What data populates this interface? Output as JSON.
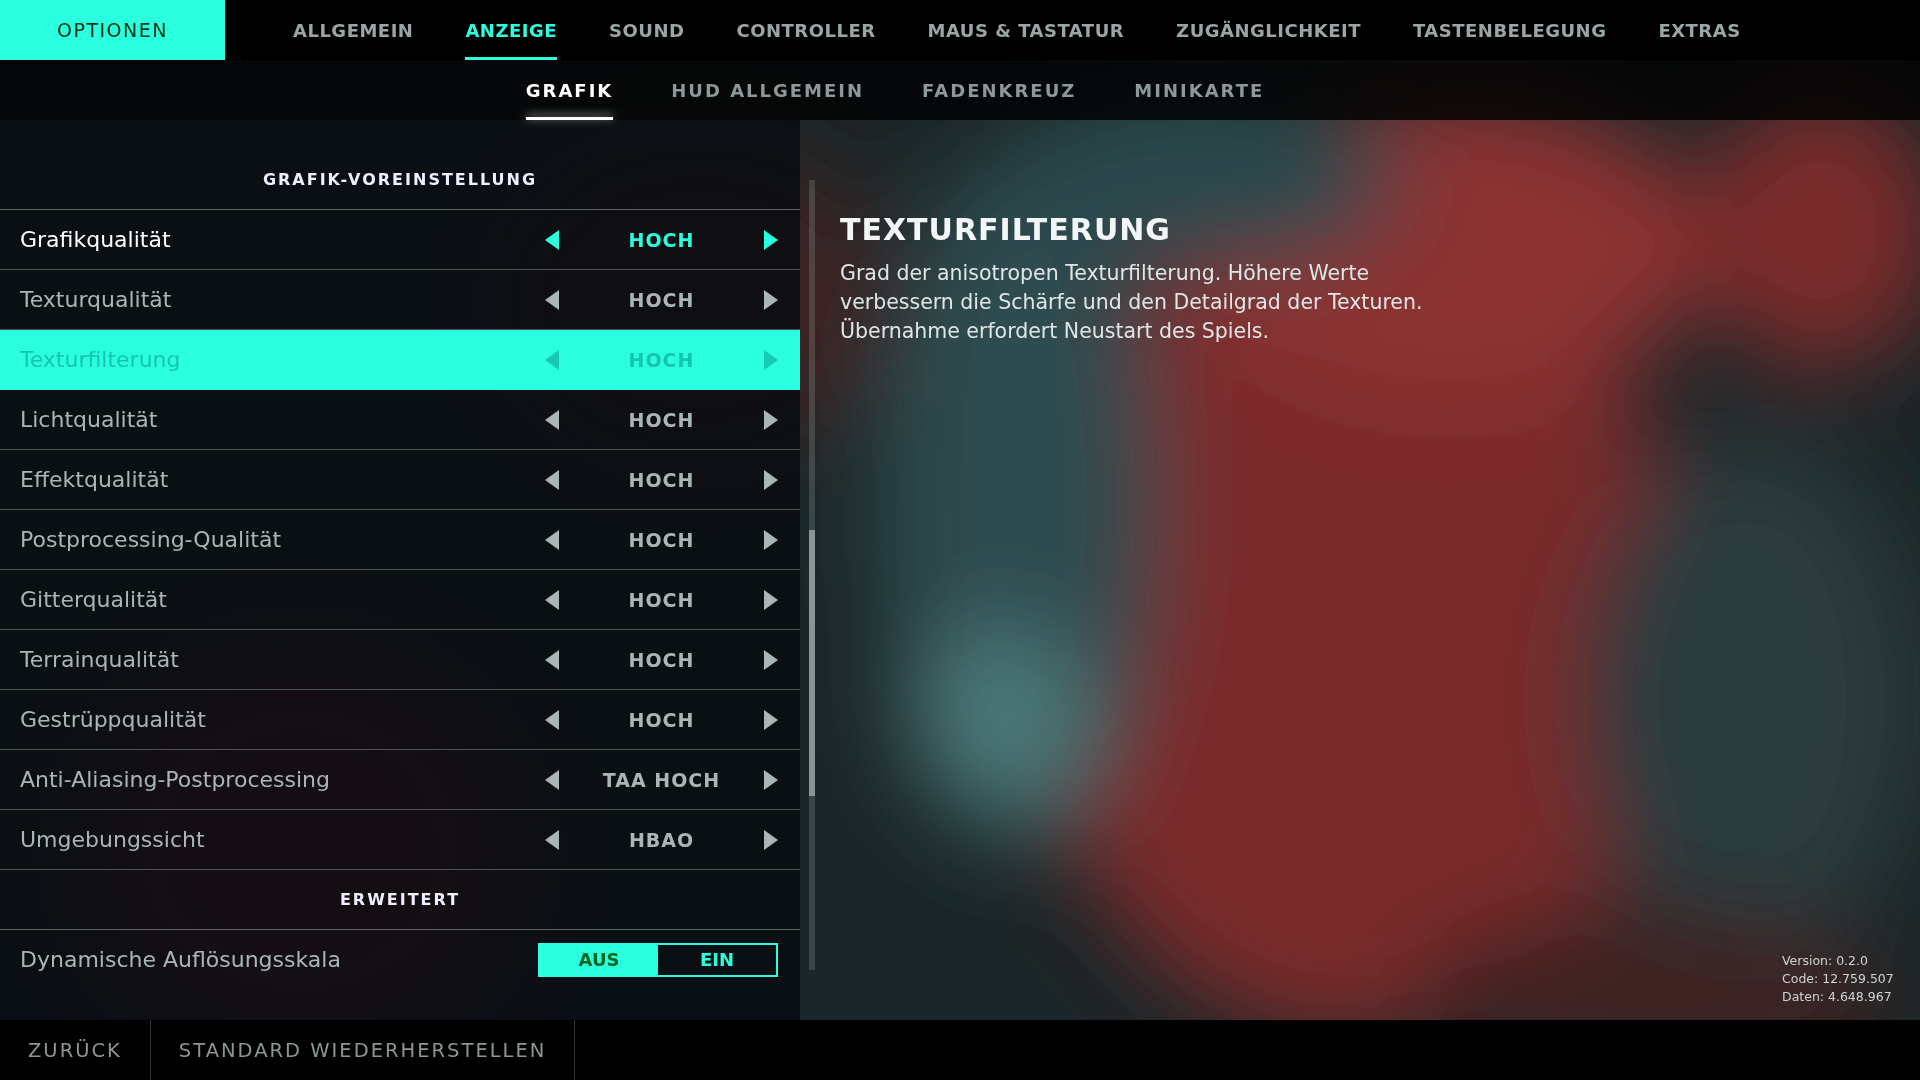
{
  "header": {
    "title": "OPTIONEN"
  },
  "tabs": [
    {
      "label": "ALLGEMEIN",
      "selected": false
    },
    {
      "label": "ANZEIGE",
      "selected": true
    },
    {
      "label": "SOUND",
      "selected": false
    },
    {
      "label": "CONTROLLER",
      "selected": false
    },
    {
      "label": "MAUS & TASTATUR",
      "selected": false
    },
    {
      "label": "ZUGÄNGLICHKEIT",
      "selected": false
    },
    {
      "label": "TASTENBELEGUNG",
      "selected": false
    },
    {
      "label": "EXTRAS",
      "selected": false
    }
  ],
  "subtabs": [
    {
      "label": "GRAFIK",
      "selected": true
    },
    {
      "label": "HUD ALLGEMEIN",
      "selected": false
    },
    {
      "label": "FADENKREUZ",
      "selected": false
    },
    {
      "label": "MINIKARTE",
      "selected": false
    }
  ],
  "settings": [
    {
      "kind": "heading",
      "label": "GRAFIK-VOREINSTELLUNG"
    },
    {
      "kind": "select",
      "label": "Grafikqualität",
      "value": "HOCH",
      "active": true,
      "selected": false
    },
    {
      "kind": "select",
      "label": "Texturqualität",
      "value": "HOCH",
      "active": false,
      "selected": false
    },
    {
      "kind": "select",
      "label": "Texturfilterung",
      "value": "HOCH",
      "active": false,
      "selected": true
    },
    {
      "kind": "select",
      "label": "Lichtqualität",
      "value": "HOCH",
      "active": false,
      "selected": false
    },
    {
      "kind": "select",
      "label": "Effektqualität",
      "value": "HOCH",
      "active": false,
      "selected": false
    },
    {
      "kind": "select",
      "label": "Postprocessing-Qualität",
      "value": "HOCH",
      "active": false,
      "selected": false
    },
    {
      "kind": "select",
      "label": "Gitterqualität",
      "value": "HOCH",
      "active": false,
      "selected": false
    },
    {
      "kind": "select",
      "label": "Terrainqualität",
      "value": "HOCH",
      "active": false,
      "selected": false
    },
    {
      "kind": "select",
      "label": "Gestrüppqualität",
      "value": "HOCH",
      "active": false,
      "selected": false
    },
    {
      "kind": "select",
      "label": "Anti-Aliasing-Postprocessing",
      "value": "TAA HOCH",
      "active": false,
      "selected": false
    },
    {
      "kind": "select",
      "label": "Umgebungssicht",
      "value": "HBAO",
      "active": false,
      "selected": false
    },
    {
      "kind": "heading",
      "label": "ERWEITERT"
    },
    {
      "kind": "toggle",
      "label": "Dynamische Auflösungsskala",
      "options": [
        {
          "label": "AUS",
          "selected": true
        },
        {
          "label": "EIN",
          "selected": false
        }
      ]
    }
  ],
  "description": {
    "title": "TEXTURFILTERUNG",
    "text": "Grad der anisotropen Texturfilterung. Höhere Werte verbessern die Schärfe und den Detailgrad der Texturen. Übernahme erfordert Neustart des Spiels."
  },
  "version_info": [
    "Version: 0.2.0",
    "Code: 12.759.507",
    "Daten: 4.648.967"
  ],
  "footer_buttons": [
    "ZURÜCK",
    "STANDARD WIEDERHERSTELLEN"
  ]
}
